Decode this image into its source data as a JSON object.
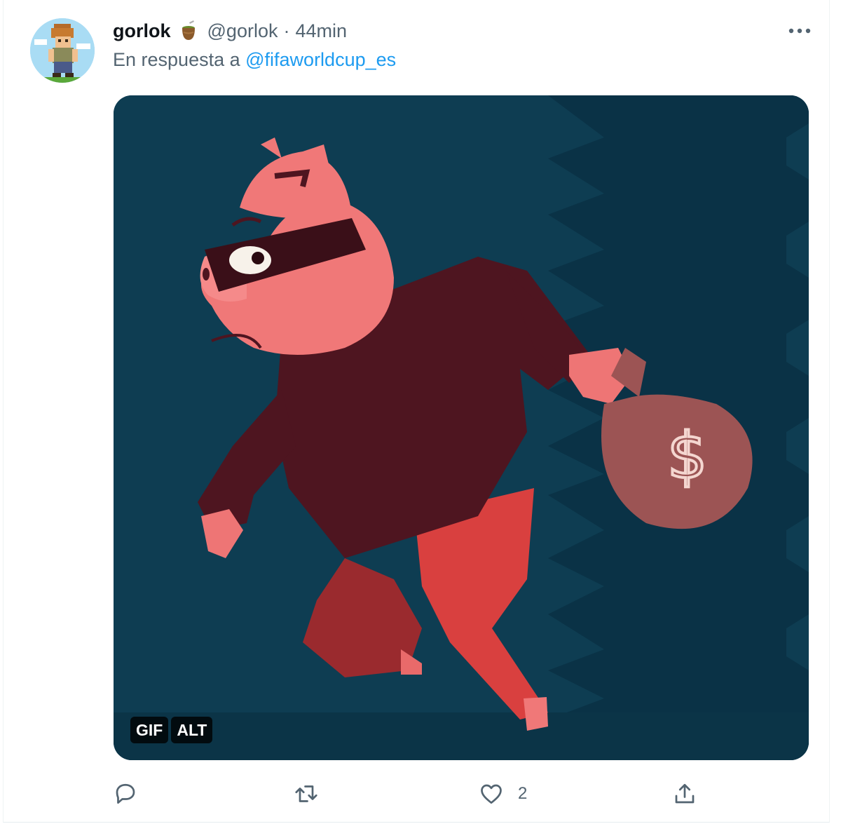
{
  "tweet": {
    "display_name": "gorlok",
    "handle": "@gorlok",
    "separator": "·",
    "time": "44min",
    "replying_prefix": "En respuesta a ",
    "replying_to": "@fifaworldcup_es"
  },
  "media": {
    "badges": [
      "GIF",
      "ALT"
    ]
  },
  "actions": {
    "reply_count": "",
    "retweet_count": "",
    "like_count": "2",
    "icons": [
      "reply-icon",
      "retweet-icon",
      "heart-icon",
      "share-icon"
    ]
  },
  "colors": {
    "link": "#1d9bf0",
    "secondary_text": "#536471",
    "media_bg": "#0e3d52"
  }
}
